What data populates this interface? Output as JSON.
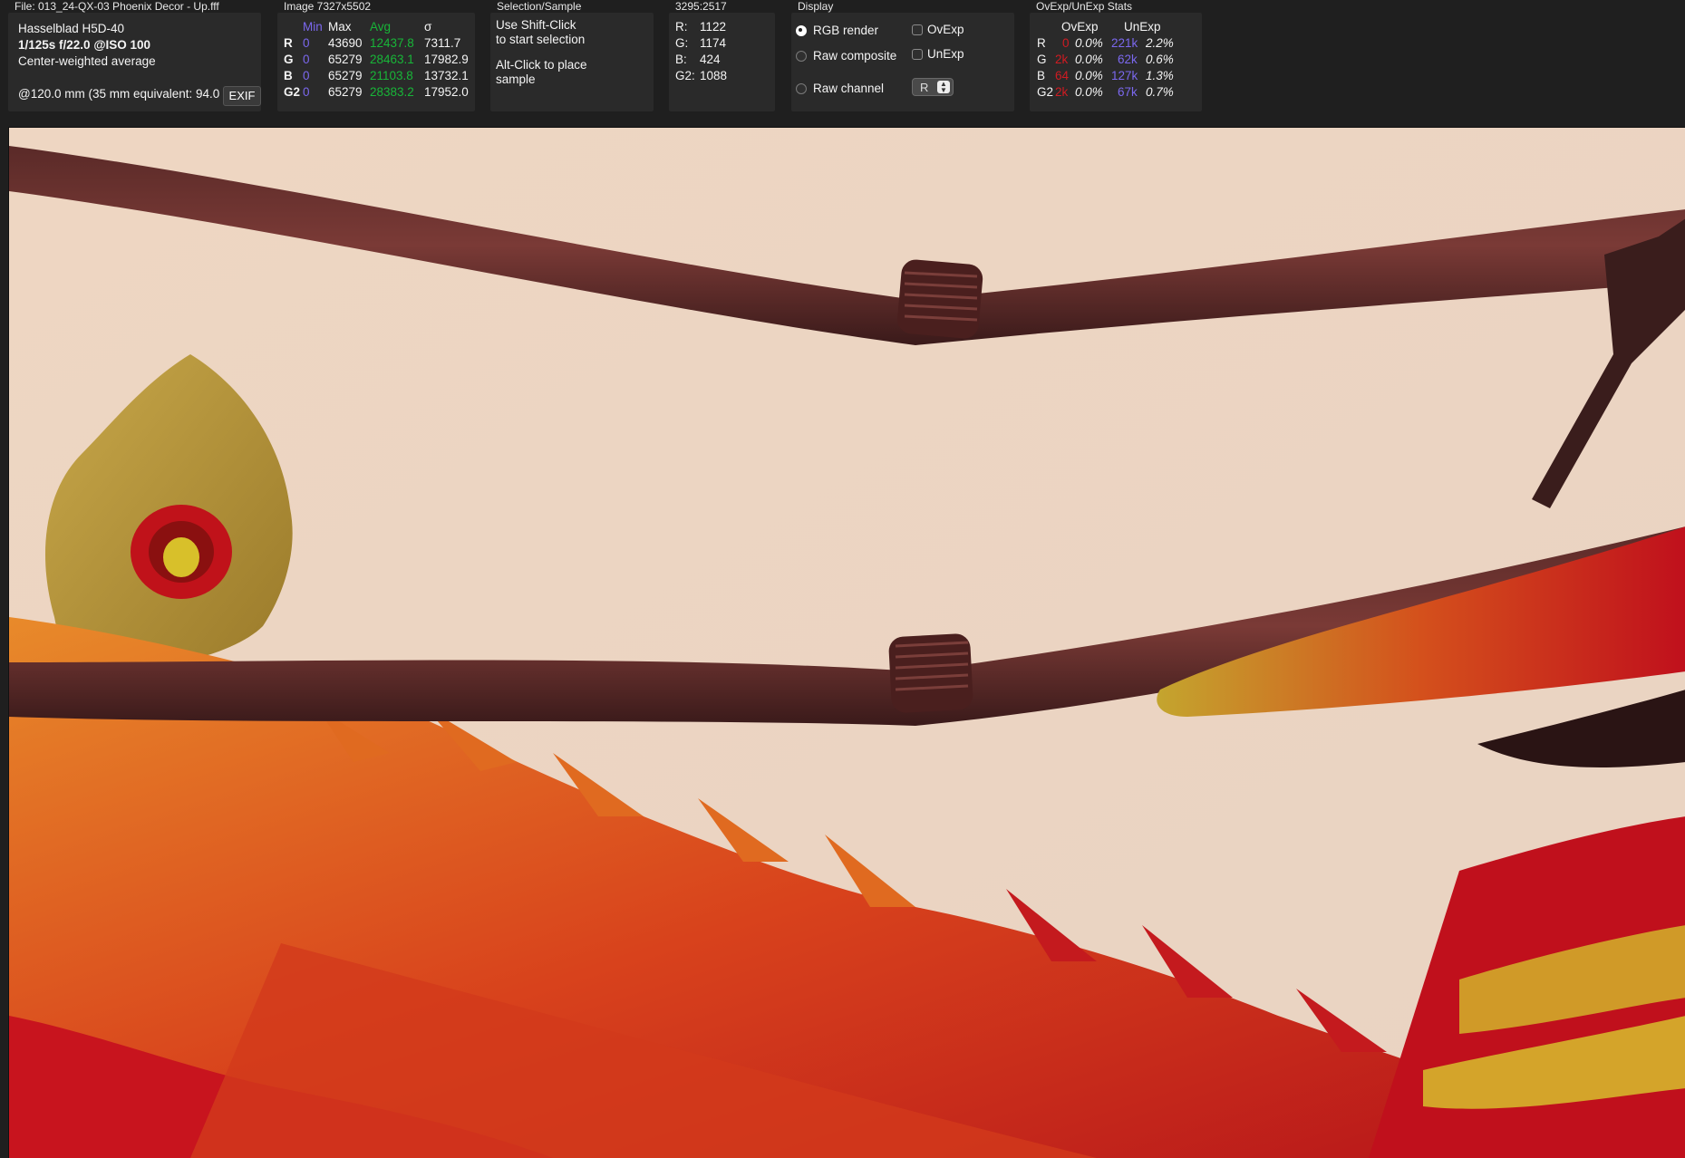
{
  "file_section": {
    "title": "File: 013_24-QX-03 Phoenix Decor - Up.fff",
    "camera": "Hasselblad H5D-40",
    "exposure": "1/125s f/22.0 @ISO 100",
    "metering": "Center-weighted average",
    "focal": "@120.0 mm (35 mm equivalent: 94.0 mm)",
    "exif_button": "EXIF"
  },
  "image_section": {
    "title": "Image 7327x5502",
    "headers": {
      "min": "Min",
      "max": "Max",
      "avg": "Avg",
      "sigma": "σ"
    },
    "rows": [
      {
        "ch": "R",
        "min": "0",
        "max": "43690",
        "avg": "12437.8",
        "sigma": "7311.7"
      },
      {
        "ch": "G",
        "min": "0",
        "max": "65279",
        "avg": "28463.1",
        "sigma": "17982.9"
      },
      {
        "ch": "B",
        "min": "0",
        "max": "65279",
        "avg": "21103.8",
        "sigma": "13732.1"
      },
      {
        "ch": "G2",
        "min": "0",
        "max": "65279",
        "avg": "28383.2",
        "sigma": "17952.0"
      }
    ]
  },
  "selection_section": {
    "title": "Selection/Sample",
    "line1": "Use Shift-Click",
    "line2": "to start selection",
    "line3": "Alt-Click to place",
    "line4": "sample"
  },
  "sample_section": {
    "title": "3295:2517",
    "rows": [
      {
        "label": "R:",
        "value": "1122"
      },
      {
        "label": "G:",
        "value": "1174"
      },
      {
        "label": "B:",
        "value": "424"
      },
      {
        "label": "G2:",
        "value": "1088"
      }
    ]
  },
  "display_section": {
    "title": "Display",
    "rgb_render": "RGB render",
    "raw_composite": "Raw composite",
    "raw_channel": "Raw channel",
    "ovexp": "OvExp",
    "unexp": "UnExp",
    "channel_select": "R",
    "selected_mode": "RGB render"
  },
  "stats_section": {
    "title": "OvExp/UnExp Stats",
    "headers": {
      "ovexp": "OvExp",
      "unexp": "UnExp"
    },
    "rows": [
      {
        "ch": "R",
        "ov_count": "0",
        "ov_pct": "0.0%",
        "un_count": "221k",
        "un_pct": "2.2%"
      },
      {
        "ch": "G",
        "ov_count": "2k",
        "ov_pct": "0.0%",
        "un_count": "62k",
        "un_pct": "0.6%"
      },
      {
        "ch": "B",
        "ov_count": "64",
        "ov_pct": "0.0%",
        "un_count": "127k",
        "un_pct": "1.3%"
      },
      {
        "ch": "G2",
        "ov_count": "2k",
        "ov_pct": "0.0%",
        "un_count": "67k",
        "un_pct": "0.7%"
      }
    ]
  },
  "colors": {
    "min_header": "#7b68ee",
    "avg_values": "#18b538",
    "ov_count": "#d01b22",
    "un_count": "#7b68ee",
    "viewer_background": "#ecd6c3"
  }
}
